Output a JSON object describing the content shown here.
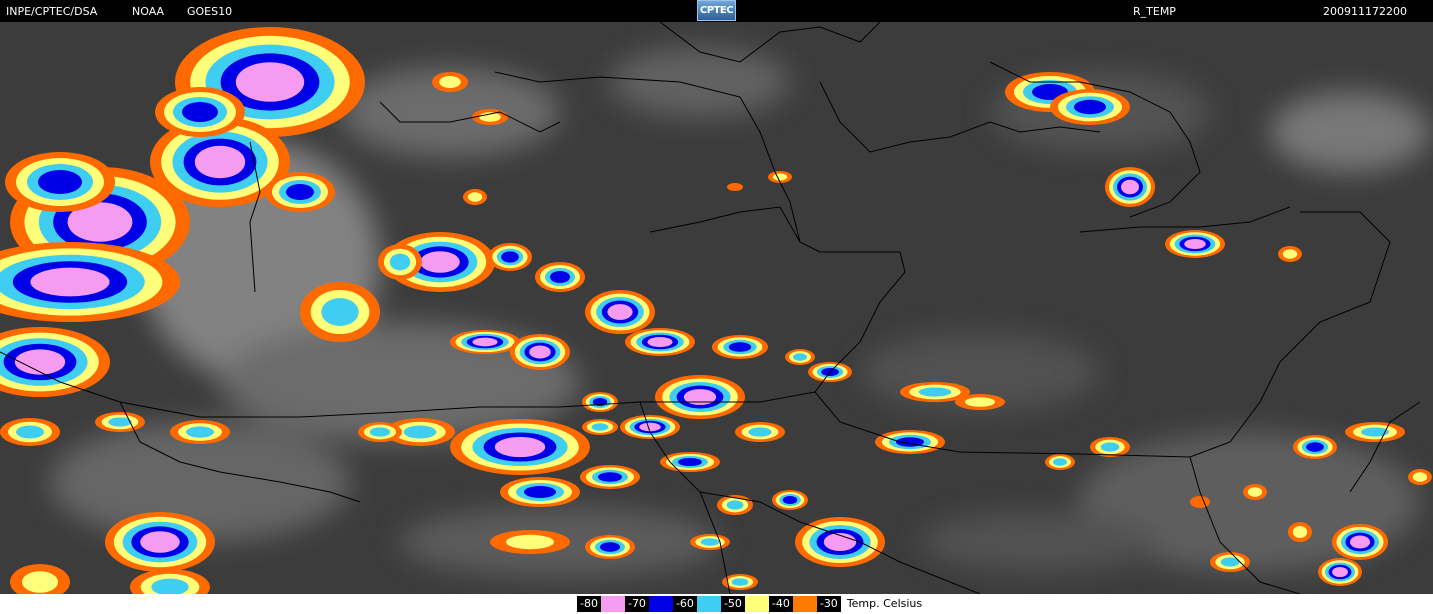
{
  "header": {
    "agency": "INPE/CPTEC/DSA",
    "provider": "NOAA",
    "satellite": "GOES10",
    "logo_text": "CPTEC",
    "product": "R_TEMP",
    "datetime": "200911172200"
  },
  "colors": {
    "background": "#3a3a3a",
    "border": "#000000",
    "cloud_gray": "#9a9a9a"
  },
  "legend": {
    "unit": "Temp. Celsius",
    "items": [
      {
        "label": "-80",
        "color": "#f59cf0"
      },
      {
        "label": "-70",
        "color": "#0000e6"
      },
      {
        "label": "-60",
        "color": "#3fcdf2"
      },
      {
        "label": "-50",
        "color": "#ffff7a"
      },
      {
        "label": "-40",
        "color": "#ff7a00"
      },
      {
        "label": "-30",
        "color": "#ff6a00"
      }
    ]
  }
}
